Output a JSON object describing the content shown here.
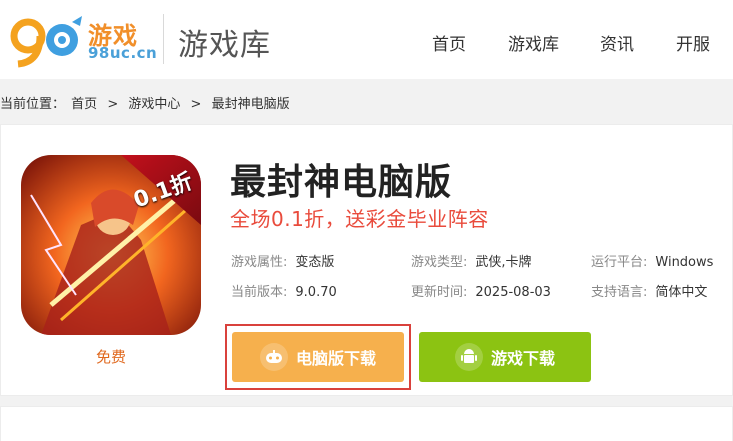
{
  "header": {
    "logo": {
      "brand": "游戏",
      "domain": "98uc.cn"
    },
    "site_title": "游戏库",
    "nav": [
      "首页",
      "游戏库",
      "资讯",
      "开服"
    ]
  },
  "breadcrumb": {
    "prefix": "当前位置：",
    "items": [
      "首页",
      "游戏中心",
      "最封神电脑版"
    ],
    "separator": ">"
  },
  "game": {
    "icon_badge": "0.1折",
    "price": "免费",
    "title": "最封神电脑版",
    "subtitle": "全场0.1折，送彩金毕业阵容",
    "info": [
      {
        "key": "游戏属性:",
        "value": "变态版"
      },
      {
        "key": "游戏类型:",
        "value": "武侠,卡牌"
      },
      {
        "key": "运行平台:",
        "value": "Windows"
      },
      {
        "key": "当前版本:",
        "value": "9.0.70"
      },
      {
        "key": "更新时间:",
        "value": "2025-08-03"
      },
      {
        "key": "支持语言:",
        "value": "简体中文"
      }
    ],
    "buttons": {
      "pc": "电脑版下载",
      "android": "游戏下载"
    }
  },
  "colors": {
    "accent_orange": "#f6b04d",
    "accent_green": "#8cc312",
    "subtitle_red": "#e94b3c",
    "highlight_outline": "#d9413c"
  }
}
